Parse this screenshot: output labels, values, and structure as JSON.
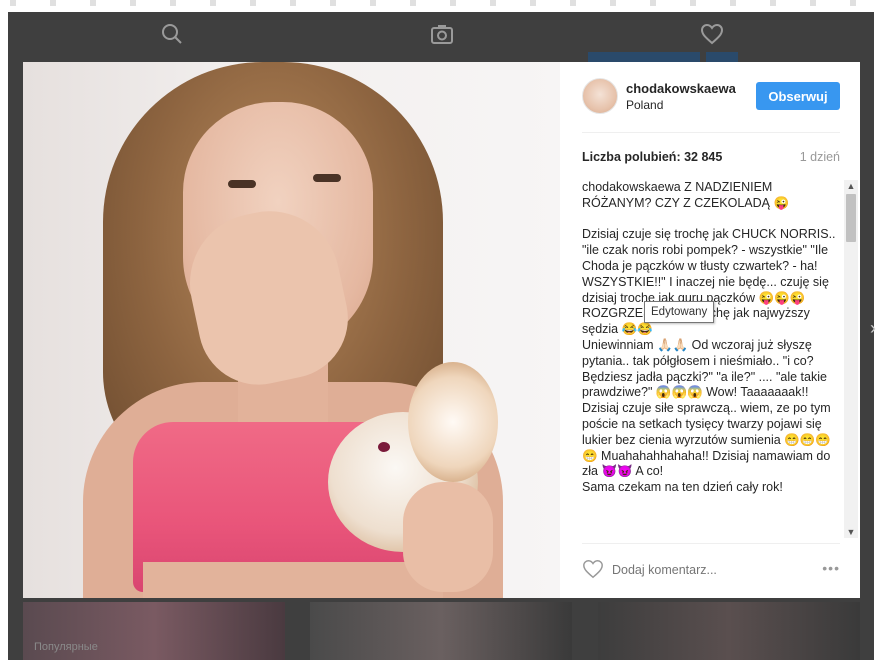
{
  "background": {
    "nav_icons": [
      "search-icon",
      "camera-icon",
      "heart-icon"
    ],
    "footer_text": "Популярные"
  },
  "post": {
    "username": "chodakowskaewa",
    "location": "Poland",
    "follow_label": "Obserwuj",
    "likes_label": "Liczba polubień: 32 845",
    "time_ago": "1 dzień",
    "caption_user": "chodakowskaewa",
    "caption_text": " Z NADZIENIEM RÓŻANYM? CZY Z CZEKOLADĄ 😜\n\nDzisiaj czuje się trochę jak CHUCK NORRIS.. \"ile czak noris robi pompek? - wszystkie\" \"Ile Choda je pączków w tłusty czwartek? - ha! WSZYSTKIE!!\" I inaczej nie będę... czuję się dzisiaj trochę jak guru pączków 😜😜😜 ROZGRZESZAM! .. trochę jak najwyższy sędzia 😂😂\nUniewinniam 🙏🏻🙏🏻 Od wczoraj już słyszę pytania.. tak półgłosem i nieśmiało.. \"i co? Będziesz jadła pączki?\" \"a ile?\" .... \"ale takie prawdziwe?\" 😱😱😱 Wow! Taaaaaaak!! Dzisiaj czuje siłe sprawczą.. wiem, ze po tym poście na setkach tysięcy twarzy pojawi się lukier bez cienia wyrzutów sumienia 😁😁😁😁 Muahahahhahaha!! Dzisiaj namawiam do zła 😈😈 A co!\nSama czekam na ten dzień cały rok!",
    "tooltip": "Edytowany",
    "comment_placeholder": "Dodaj komentarz...",
    "more_label": "•••"
  },
  "colors": {
    "accent": "#3897f0",
    "backdrop": "#3f3f3f",
    "text": "#262626",
    "muted": "#999999"
  }
}
